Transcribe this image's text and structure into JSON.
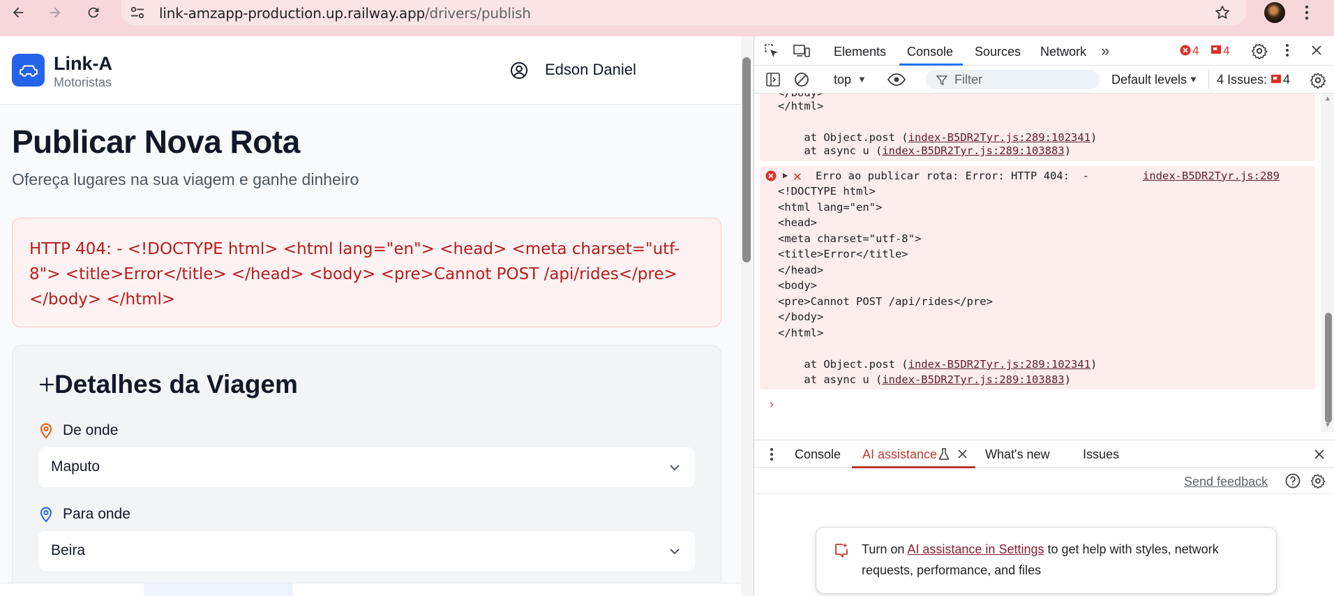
{
  "browser": {
    "url_host": "link-amzapp-production.up.railway.app",
    "url_path": "/drivers/publish"
  },
  "app": {
    "brand": "Link-A",
    "brand_sub": "Motoristas",
    "user_name": "Edson Daniel",
    "page_title": "Publicar Nova Rota",
    "page_subtitle": "Ofereça lugares na sua viagem e ganhe dinheiro",
    "error_message": "HTTP 404: - <!DOCTYPE html> <html lang=\"en\"> <head> <meta charset=\"utf-8\"> <title>Error</title> </head> <body> <pre>Cannot POST /api/rides</pre> </body> </html>",
    "card_title": "Detalhes da Viagem",
    "from_label": "De onde",
    "from_value": "Maputo",
    "to_label": "Para onde",
    "to_value": "Beira"
  },
  "devtools": {
    "tabs": [
      "Elements",
      "Console",
      "Sources",
      "Network"
    ],
    "error_count": "4",
    "issue_flag_count": "4",
    "context": "top",
    "filter_placeholder": "Filter",
    "levels": "Default levels",
    "issues_label": "4 Issues:",
    "issues_count": "4",
    "log": {
      "prev_tail": [
        "</body>",
        "</html>"
      ],
      "prev_stack": [
        {
          "prefix": "    at Object.post (",
          "link": "index-B5DR2Tyr.js:289:102341",
          "suffix": ")"
        },
        {
          "prefix": "    at async u (",
          "link": "index-B5DR2Tyr.js:289:103883",
          "suffix": ")"
        }
      ],
      "error_head": "Erro ao publicar rota: Error: HTTP 404:  -",
      "error_source": "index-B5DR2Tyr.js:289",
      "error_body": [
        "<!DOCTYPE html>",
        "<html lang=\"en\">",
        "<head>",
        "<meta charset=\"utf-8\">",
        "<title>Error</title>",
        "</head>",
        "<body>",
        "<pre>Cannot POST /api/rides</pre>",
        "</body>",
        "</html>"
      ],
      "stack": [
        {
          "prefix": "    at Object.post (",
          "link": "index-B5DR2Tyr.js:289:102341",
          "suffix": ")"
        },
        {
          "prefix": "    at async u (",
          "link": "index-B5DR2Tyr.js:289:103883",
          "suffix": ")"
        }
      ]
    },
    "drawer_tabs": [
      "Console",
      "AI assistance",
      "What's new",
      "Issues"
    ],
    "send_feedback": "Send feedback",
    "ai_prefix": "Turn on ",
    "ai_link": "AI assistance in Settings",
    "ai_suffix": " to get help with styles, network requests, performance, and files"
  }
}
